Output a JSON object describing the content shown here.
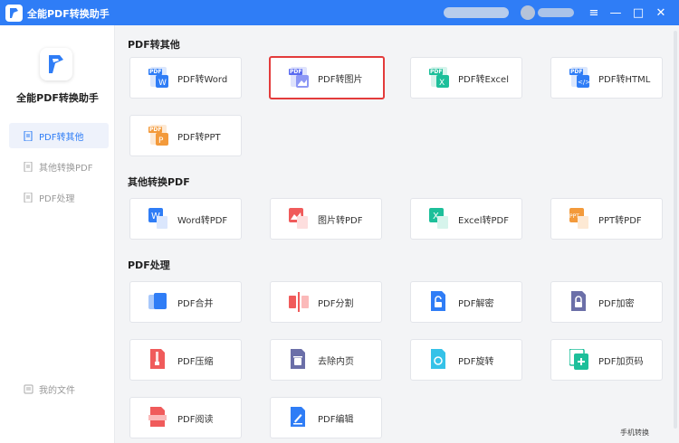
{
  "window": {
    "title": "全能PDF转换助手",
    "minimize": "—",
    "restore": "□",
    "close": "✕",
    "menu": "≡"
  },
  "sidebar": {
    "app_name": "全能PDF转换助手",
    "items": [
      {
        "label": "PDF转其他"
      },
      {
        "label": "其他转换PDF"
      },
      {
        "label": "PDF处理"
      }
    ],
    "my_files": "我的文件"
  },
  "sections": [
    {
      "title": "PDF转其他",
      "cards": [
        {
          "label": "PDF转Word",
          "icon": "pdf-to-word-icon",
          "color": "#2f7df6"
        },
        {
          "label": "PDF转图片",
          "icon": "pdf-to-image-icon",
          "color": "#5b6cf0"
        },
        {
          "label": "PDF转Excel",
          "icon": "pdf-to-excel-icon",
          "color": "#1dbf9a"
        },
        {
          "label": "PDF转HTML",
          "icon": "pdf-to-html-icon",
          "color": "#2f7df6"
        },
        {
          "label": "PDF转PPT",
          "icon": "pdf-to-ppt-icon",
          "color": "#f39a3b"
        }
      ]
    },
    {
      "title": "其他转换PDF",
      "cards": [
        {
          "label": "Word转PDF",
          "icon": "word-to-pdf-icon",
          "color": "#2f7df6"
        },
        {
          "label": "图片转PDF",
          "icon": "image-to-pdf-icon",
          "color": "#f05b5b"
        },
        {
          "label": "Excel转PDF",
          "icon": "excel-to-pdf-icon",
          "color": "#1dbf9a"
        },
        {
          "label": "PPT转PDF",
          "icon": "ppt-to-pdf-icon",
          "color": "#f39a3b"
        }
      ]
    },
    {
      "title": "PDF处理",
      "cards": [
        {
          "label": "PDF合并",
          "icon": "merge-icon",
          "color": "#2f7df6"
        },
        {
          "label": "PDF分割",
          "icon": "split-icon",
          "color": "#f05b5b"
        },
        {
          "label": "PDF解密",
          "icon": "decrypt-icon",
          "color": "#2f7df6"
        },
        {
          "label": "PDF加密",
          "icon": "encrypt-icon",
          "color": "#6b6fa8"
        },
        {
          "label": "PDF压缩",
          "icon": "compress-icon",
          "color": "#f05b5b"
        },
        {
          "label": "去除内页",
          "icon": "remove-page-icon",
          "color": "#6b6fa8"
        },
        {
          "label": "PDF旋转",
          "icon": "rotate-icon",
          "color": "#35c2e8"
        },
        {
          "label": "PDF加页码",
          "icon": "page-number-icon",
          "color": "#1dbf9a"
        },
        {
          "label": "PDF阅读",
          "icon": "read-icon",
          "color": "#f05b5b"
        },
        {
          "label": "PDF编辑",
          "icon": "edit-icon",
          "color": "#2f7df6"
        }
      ]
    }
  ],
  "bottom_link": "手机转换",
  "accent": "#2f7df6"
}
